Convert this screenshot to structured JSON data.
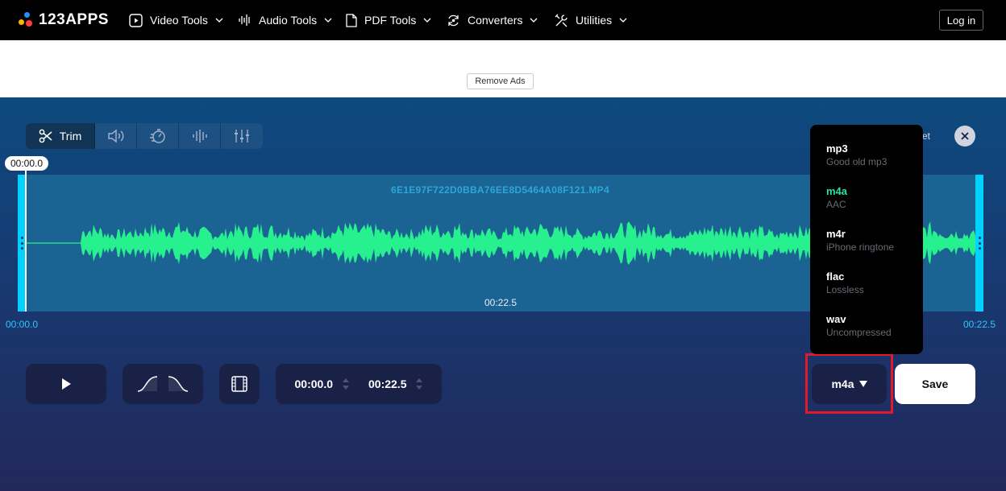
{
  "nav": {
    "brand": "123APPS",
    "items": [
      {
        "label": "Video Tools",
        "icon": "play-square-icon"
      },
      {
        "label": "Audio Tools",
        "icon": "audio-wave-icon"
      },
      {
        "label": "PDF Tools",
        "icon": "document-icon"
      },
      {
        "label": "Converters",
        "icon": "convert-arrows-icon"
      },
      {
        "label": "Utilities",
        "icon": "tools-icon"
      }
    ],
    "login": "Log in"
  },
  "ads": {
    "remove_label": "Remove Ads"
  },
  "toolbar": {
    "active_label": "Trim",
    "tools": [
      "scissors-icon",
      "volume-icon",
      "speed-icon",
      "equalizer-icon",
      "mixer-sliders-icon"
    ]
  },
  "editor": {
    "playhead_time": "00:00.0",
    "filename": "6E1E97F722D0BBA76EE8D5464A08F121.MP4",
    "duration_center": "00:22.5",
    "start_label": "00:00.0",
    "end_label": "00:22.5",
    "obscured_text": "et"
  },
  "controls": {
    "start_time": "00:00.0",
    "end_time": "00:22.5",
    "format_selected": "m4a",
    "save_label": "Save"
  },
  "format_menu": {
    "options": [
      {
        "name": "mp3",
        "desc": "Good old mp3"
      },
      {
        "name": "m4a",
        "desc": "AAC"
      },
      {
        "name": "m4r",
        "desc": "iPhone ringtone"
      },
      {
        "name": "flac",
        "desc": "Lossless"
      },
      {
        "name": "wav",
        "desc": "Uncompressed"
      }
    ],
    "selected": "m4a"
  },
  "colors": {
    "waveform": "#27f08f",
    "handle": "#00d1ff",
    "highlight": "#e0192b",
    "selected_option": "#27e39b"
  }
}
